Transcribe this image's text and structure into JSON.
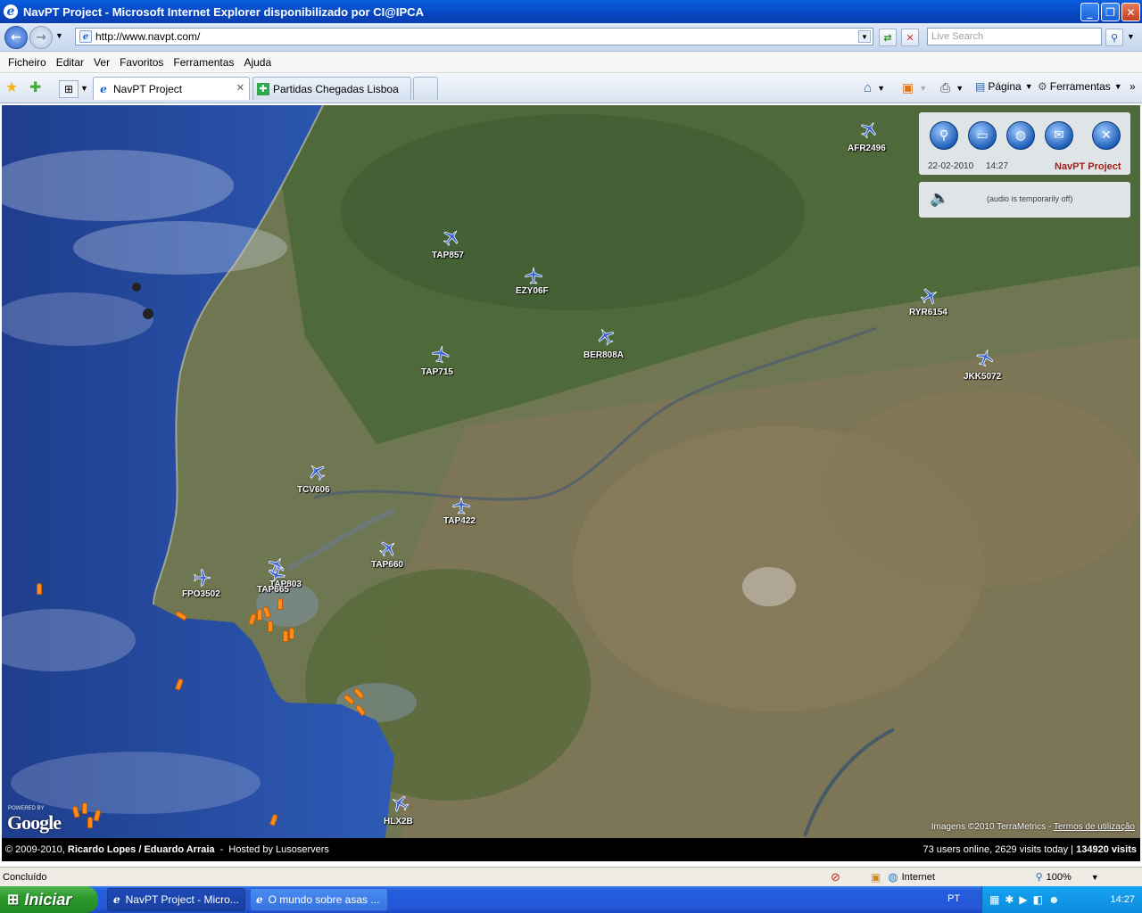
{
  "window": {
    "title": "NavPT Project - Microsoft Internet Explorer disponibilizado por CI@IPCA"
  },
  "address": {
    "url": "http://www.navpt.com/",
    "search_placeholder": "Live Search"
  },
  "menu": [
    "Ficheiro",
    "Editar",
    "Ver",
    "Favoritos",
    "Ferramentas",
    "Ajuda"
  ],
  "tabs": [
    {
      "label": "NavPT Project",
      "active": true
    },
    {
      "label": "Partidas Chegadas Lisboa",
      "active": false
    }
  ],
  "commandbar": {
    "page_label": "Página",
    "tools_label": "Ferramentas"
  },
  "panel": {
    "date": "22-02-2010",
    "time": "14:27",
    "brand": "NavPT Project",
    "audio_note": "(audio is temporarily off)"
  },
  "flights": [
    {
      "callsign": "AFR2496"
    },
    {
      "callsign": "TAP857"
    },
    {
      "callsign": "EZY06F"
    },
    {
      "callsign": "RYR6154"
    },
    {
      "callsign": "BER808A"
    },
    {
      "callsign": "TAP715"
    },
    {
      "callsign": "JKK5072"
    },
    {
      "callsign": "TCV606"
    },
    {
      "callsign": "TAP422"
    },
    {
      "callsign": "TAP660"
    },
    {
      "callsign": "TAP803"
    },
    {
      "callsign": "TAP665"
    },
    {
      "callsign": "FPO3502"
    },
    {
      "callsign": "HLX2B"
    }
  ],
  "map": {
    "google_logo": "Google",
    "powered_by": "POWERED BY",
    "imagery_credit": "Imagens ©2010 TerraMetrics",
    "terms_link": "Termos de utilização"
  },
  "footer": {
    "copyright": "© 2009-2010,",
    "authors": "Ricardo Lopes / Eduardo Arraia",
    "hosted": "Hosted by Lusoservers",
    "stats": "73 users online, 2629 visits today |",
    "total_visits": "134920 visits"
  },
  "status": {
    "text": "Concluído",
    "zone": "Internet",
    "zoom": "100%"
  },
  "taskbar": {
    "start": "Iniciar",
    "items": [
      "NavPT Project - Micro...",
      "O mundo sobre asas ..."
    ],
    "lang": "PT",
    "clock": "14:27"
  }
}
